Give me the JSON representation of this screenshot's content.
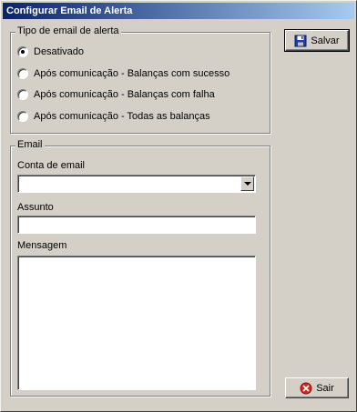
{
  "window": {
    "title": "Configurar Email de Alerta"
  },
  "alert_type": {
    "legend": "Tipo de email de alerta",
    "options": [
      {
        "label": "Desativado",
        "checked": true
      },
      {
        "label": "Após comunicação - Balanças com sucesso",
        "checked": false
      },
      {
        "label": "Após comunicação - Balanças com falha",
        "checked": false
      },
      {
        "label": "Após comunicação - Todas as balanças",
        "checked": false
      }
    ]
  },
  "email": {
    "legend": "Email",
    "account_label": "Conta de email",
    "account_value": "",
    "subject_label": "Assunto",
    "subject_value": "",
    "message_label": "Mensagem",
    "message_value": ""
  },
  "buttons": {
    "save_label": "Salvar",
    "exit_label": "Sair"
  },
  "icons": {
    "save": "floppy-disk-icon",
    "exit": "cancel-icon"
  }
}
